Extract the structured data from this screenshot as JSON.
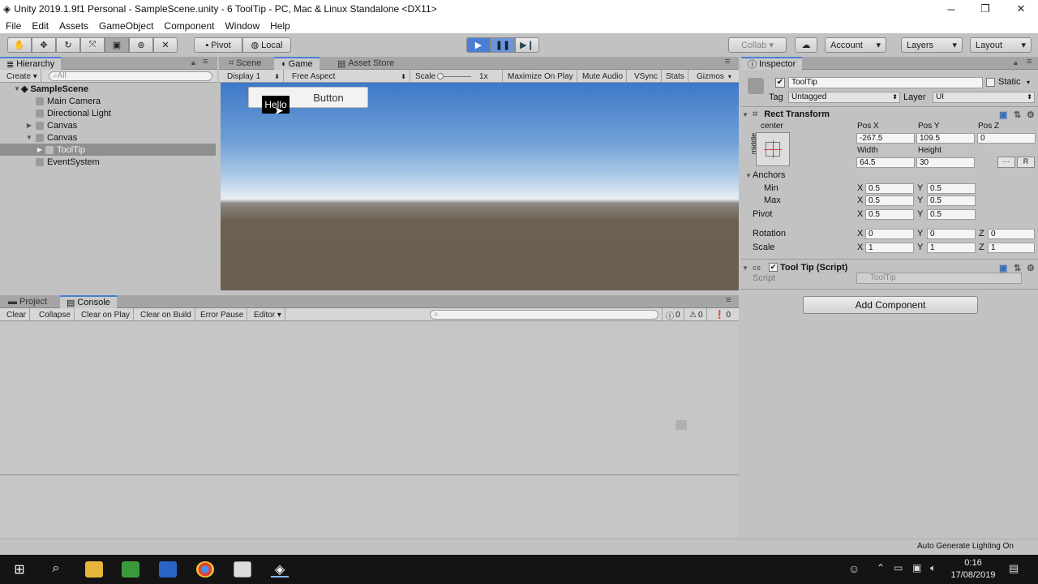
{
  "window": {
    "title": "Unity 2019.1.9f1 Personal - SampleScene.unity - 6 ToolTip - PC, Mac & Linux Standalone <DX11>",
    "minimize": "─",
    "restore": "❐",
    "close": "✕"
  },
  "menu": [
    "File",
    "Edit",
    "Assets",
    "GameObject",
    "Component",
    "Window",
    "Help"
  ],
  "toolbar": {
    "pivot": "Pivot",
    "local": "Local",
    "collab": "Collab ▾",
    "account": "Account",
    "layers": "Layers",
    "layout": "Layout",
    "accent": "#4a7fd1"
  },
  "hierarchy": {
    "tab": "Hierarchy",
    "create": "Create ▾",
    "search_placeholder": "All",
    "scene": "SampleScene",
    "items": [
      "Main Camera",
      "Directional Light",
      "Canvas",
      "Canvas",
      "ToolTip",
      "EventSystem"
    ]
  },
  "game": {
    "tabs": [
      "Scene",
      "Game",
      "Asset Store"
    ],
    "display": "Display 1",
    "aspect": "Free Aspect",
    "scale_label": "Scale",
    "scale_value": "1x",
    "maximize": "Maximize On Play",
    "mute": "Mute Audio",
    "vsync": "VSync",
    "stats": "Stats",
    "gizmos": "Gizmos",
    "button_label": "Button",
    "tooltip_text": "Hello"
  },
  "console": {
    "tabs": [
      "Project",
      "Console"
    ],
    "buttons": [
      "Clear",
      "Collapse",
      "Clear on Play",
      "Clear on Build",
      "Error Pause",
      "Editor ▾"
    ],
    "info_count": "0",
    "warn_count": "0",
    "error_count": "0"
  },
  "inspector": {
    "tab": "Inspector",
    "object_name": "ToolTip",
    "static_label": "Static",
    "tag_label": "Tag",
    "tag_value": "Untagged",
    "layer_label": "Layer",
    "layer_value": "UI",
    "rect_transform": "Rect Transform",
    "anchor_h": "center",
    "anchor_v": "middle",
    "posx_label": "Pos X",
    "posy_label": "Pos Y",
    "posz_label": "Pos Z",
    "posx": "-267.5",
    "posy": "109.5",
    "posz": "0",
    "width_label": "Width",
    "height_label": "Height",
    "width": "64.5",
    "height": "30",
    "anchors_label": "Anchors",
    "min_label": "Min",
    "max_label": "Max",
    "pivot_label": "Pivot",
    "anchor_min_x": "0.5",
    "anchor_min_y": "0.5",
    "anchor_max_x": "0.5",
    "anchor_max_y": "0.5",
    "pivot_x": "0.5",
    "pivot_y": "0.5",
    "rotation_label": "Rotation",
    "scale_label": "Scale",
    "rot_x": "0",
    "rot_y": "0",
    "rot_z": "0",
    "scale_x": "1",
    "scale_y": "1",
    "scale_z": "1",
    "tooltip_script": "Tool Tip (Script)",
    "script_label": "Script",
    "script_value": "ToolTip",
    "add_component": "Add Component",
    "r_button": "R"
  },
  "status": {
    "auto_lighting": "Auto Generate Lighting On"
  },
  "taskbar": {
    "time": "0:16",
    "date": "17/08/2019"
  }
}
